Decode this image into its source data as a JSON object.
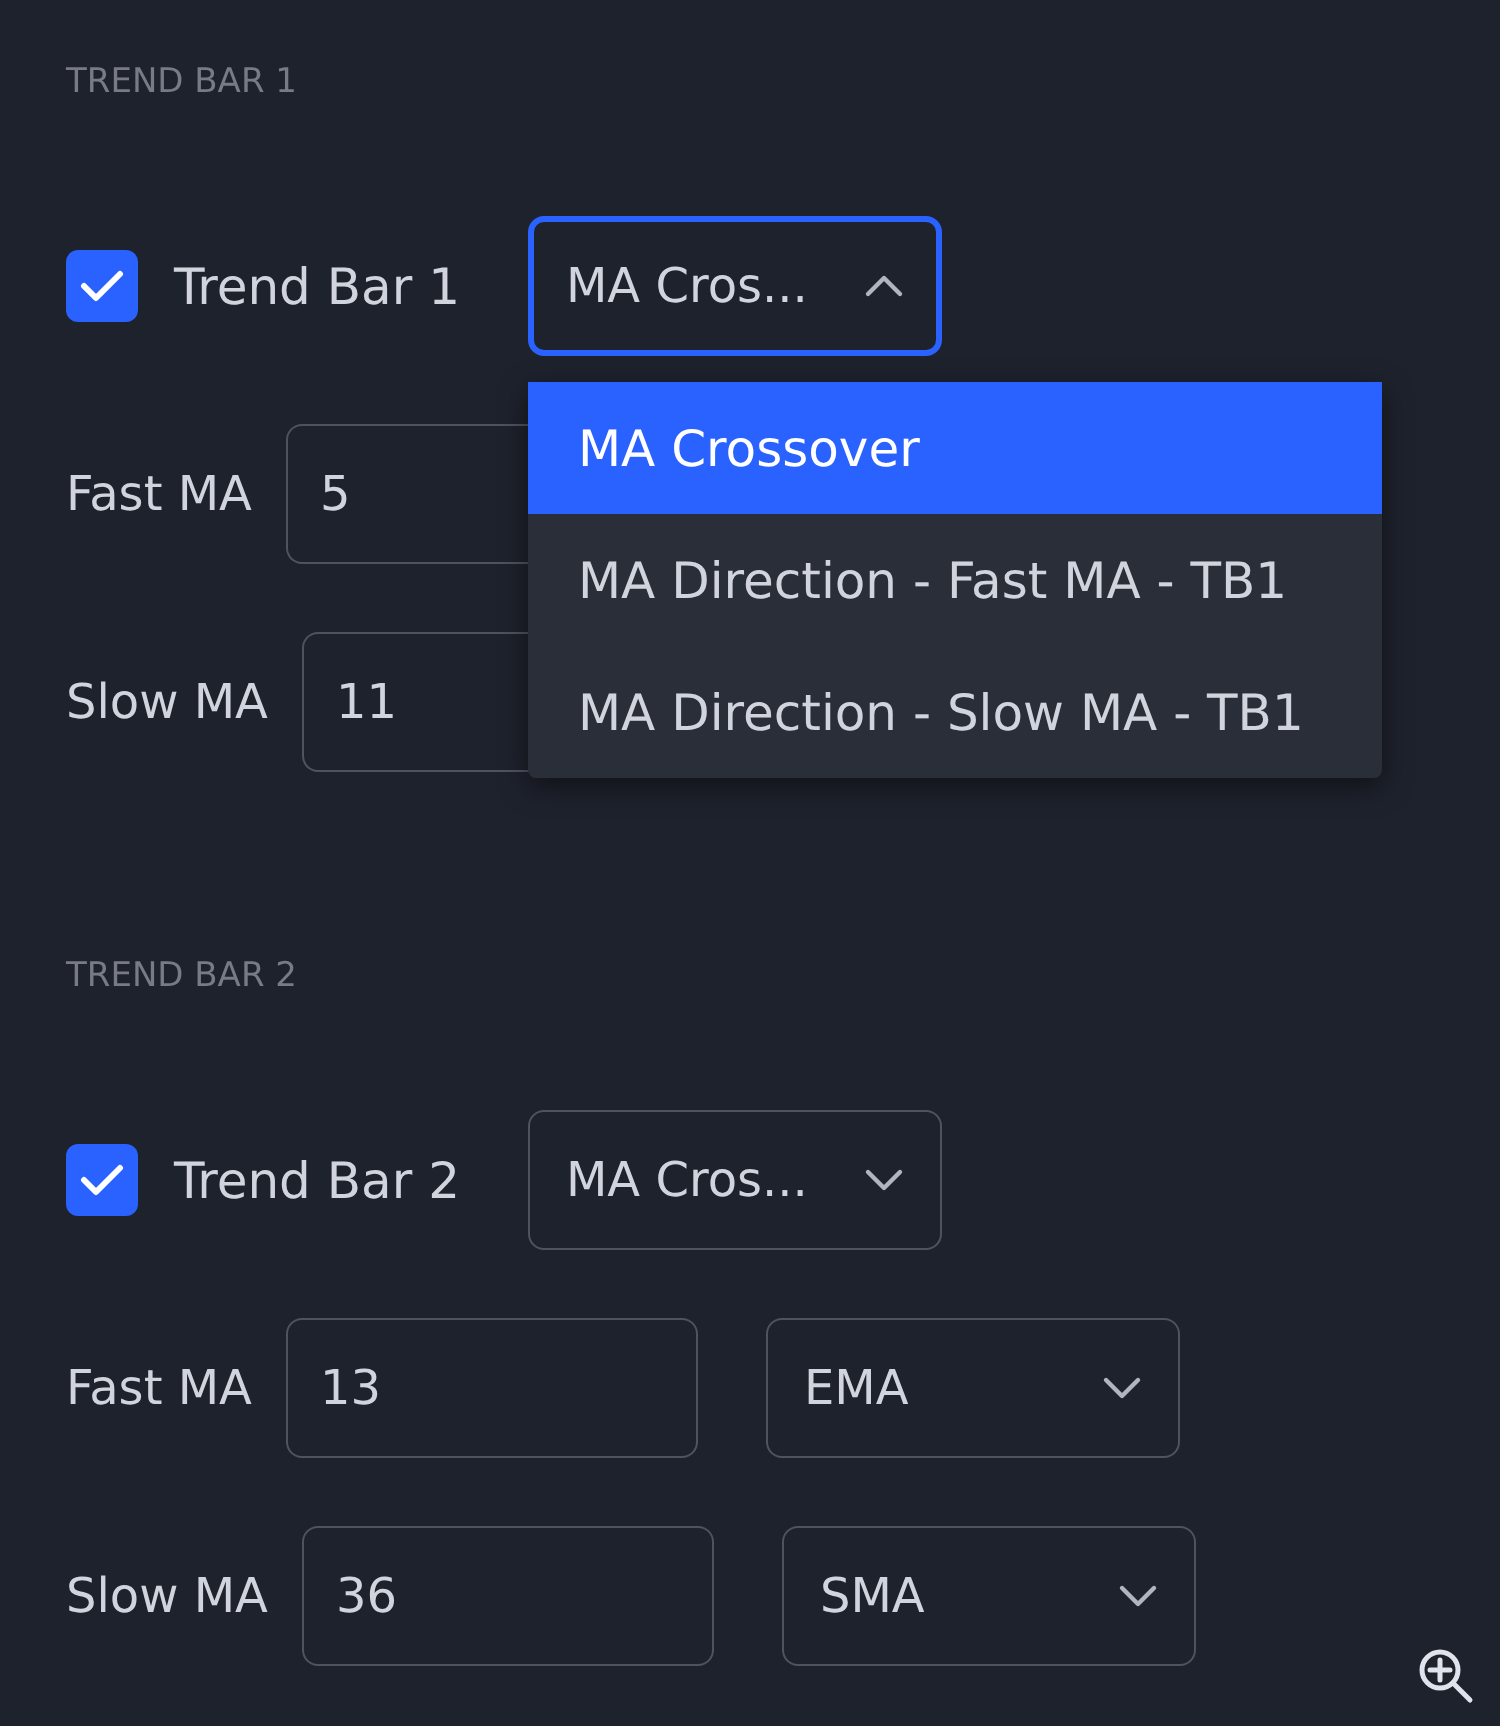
{
  "sections": [
    {
      "title": "TREND BAR 1",
      "toggle": {
        "label": "Trend Bar 1",
        "checked": true
      },
      "mode": {
        "value": "MA Cros...",
        "expanded": true,
        "options": [
          {
            "label": "MA Crossover",
            "selected": true
          },
          {
            "label": "MA Direction - Fast MA - TB1",
            "selected": false
          },
          {
            "label": "MA Direction - Slow MA - TB1",
            "selected": false
          }
        ]
      },
      "fields": [
        {
          "label": "Fast MA",
          "value": "5"
        },
        {
          "label": "Slow MA",
          "value": "11"
        }
      ]
    },
    {
      "title": "TREND BAR 2",
      "toggle": {
        "label": "Trend Bar 2",
        "checked": true
      },
      "mode": {
        "value": "MA Cros...",
        "expanded": false
      },
      "fields": [
        {
          "label": "Fast MA",
          "value": "13",
          "type": "EMA"
        },
        {
          "label": "Slow MA",
          "value": "36",
          "type": "SMA"
        }
      ]
    }
  ]
}
